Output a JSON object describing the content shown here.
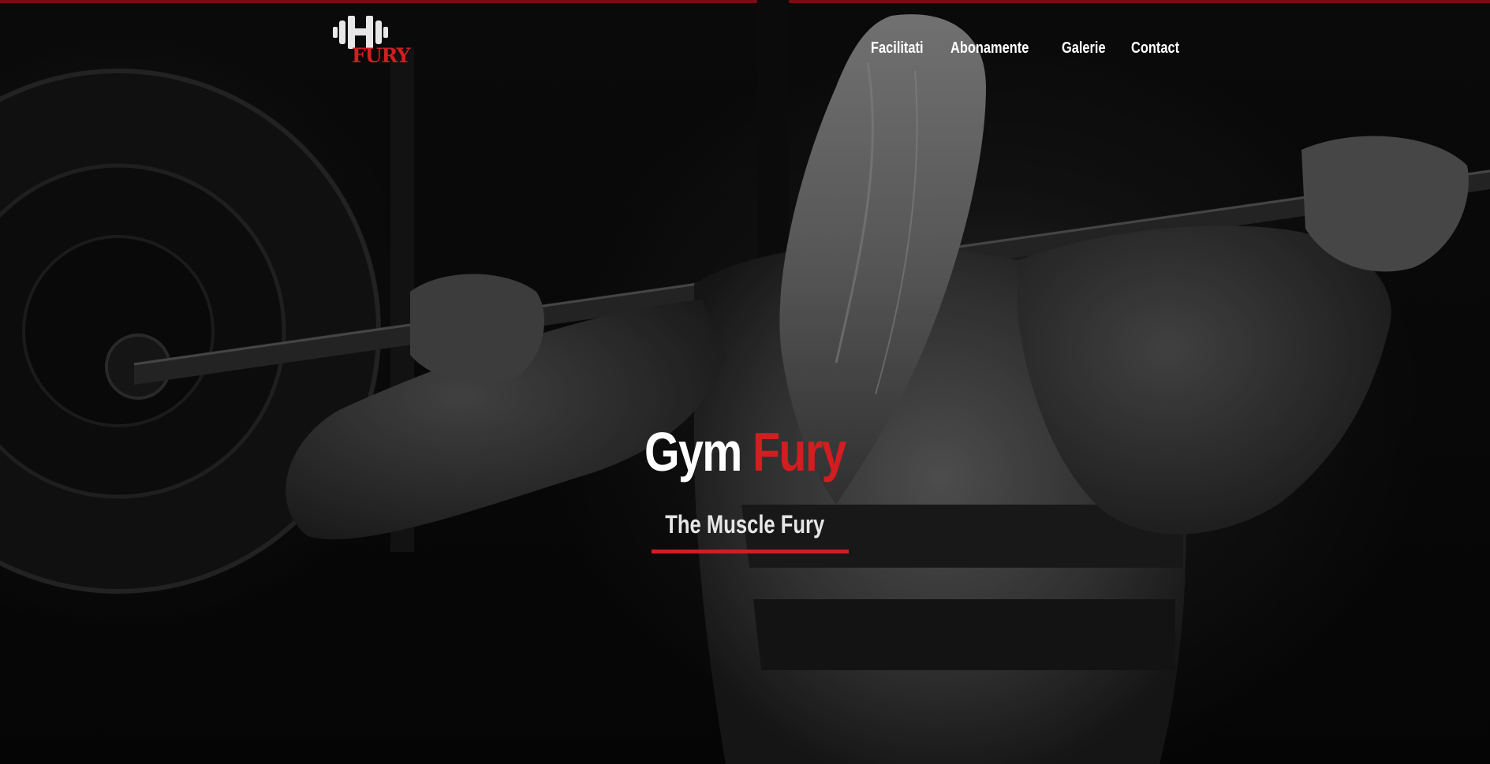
{
  "brand": {
    "logo_icon": "dumbbell-h-icon",
    "logo_text": "FURY",
    "accent_color": "#d21d21",
    "bar_color": "#8e1216"
  },
  "nav": {
    "items": [
      {
        "label": "Facilitati"
      },
      {
        "label": "Abonamente"
      },
      {
        "label": "Galerie"
      },
      {
        "label": "Contact"
      }
    ]
  },
  "hero": {
    "title_part1": "Gym",
    "title_part2": "Fury",
    "subtitle": "The Muscle Fury"
  }
}
